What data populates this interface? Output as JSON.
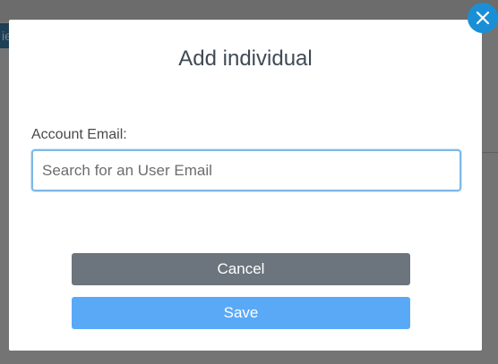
{
  "background": {
    "tab_fragment": "ie"
  },
  "modal": {
    "title": "Add individual",
    "email_label": "Account Email:",
    "email_value": "",
    "email_placeholder": "Search for an User Email",
    "cancel_label": "Cancel",
    "save_label": "Save",
    "close_icon": "close-icon"
  },
  "colors": {
    "close_button": "#1a8fd6",
    "cancel_button": "#6c757d",
    "save_button": "#5aa9f7",
    "input_focus_border": "#7fb9e8"
  }
}
